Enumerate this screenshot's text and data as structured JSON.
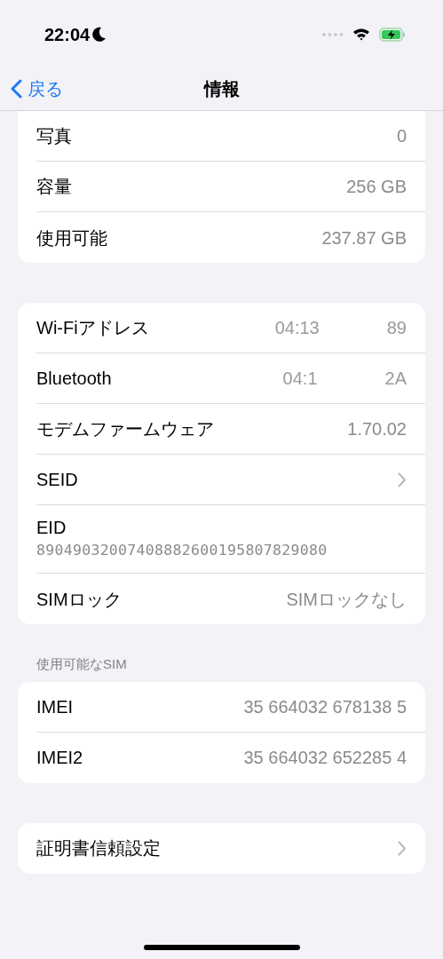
{
  "status_bar": {
    "time": "22:04"
  },
  "nav": {
    "back": "戻る",
    "title": "情報"
  },
  "sections": [
    {
      "rows": [
        {
          "kind": "value",
          "label": "写真",
          "value": "0"
        },
        {
          "kind": "value",
          "label": "容量",
          "value": "256 GB"
        },
        {
          "kind": "value",
          "label": "使用可能",
          "value": "237.87 GB"
        }
      ]
    },
    {
      "rows": [
        {
          "kind": "masked",
          "label": "Wi-Fiアドレス",
          "value_start": "04:13",
          "value_end": "89"
        },
        {
          "kind": "masked",
          "label": "Bluetooth",
          "value_start": "04:1",
          "value_end": "2A"
        },
        {
          "kind": "value",
          "label": "モデムファームウェア",
          "value": "1.70.02"
        },
        {
          "kind": "chevron",
          "label": "SEID"
        },
        {
          "kind": "stacked",
          "label": "EID",
          "value": "89049032007408882600195807829080"
        },
        {
          "kind": "value",
          "label": "SIMロック",
          "value": "SIMロックなし"
        }
      ]
    },
    {
      "header": "使用可能なSIM",
      "rows": [
        {
          "kind": "value",
          "label": "IMEI",
          "value": "35 664032 678138 5"
        },
        {
          "kind": "value",
          "label": "IMEI2",
          "value": "35 664032 652285 4"
        }
      ]
    },
    {
      "rows": [
        {
          "kind": "chevron",
          "label": "証明書信頼設定"
        }
      ]
    }
  ]
}
